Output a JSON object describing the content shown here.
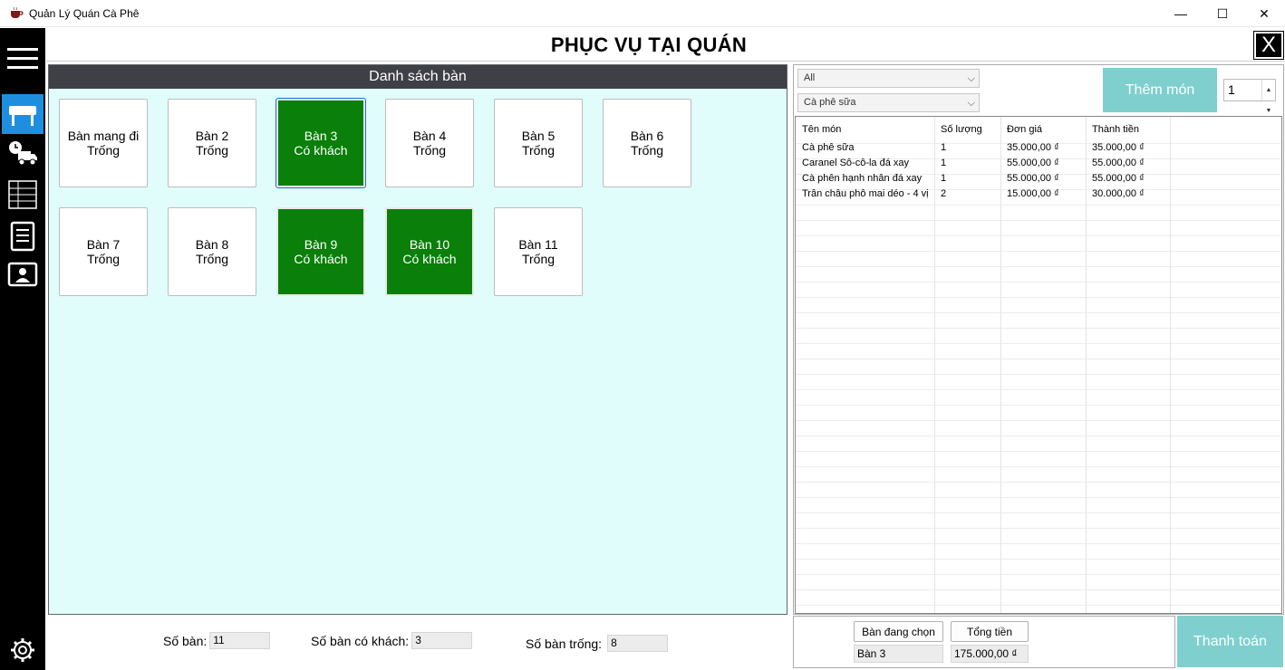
{
  "window": {
    "title": "Quản Lý Quán Cà Phê",
    "minimize": "—",
    "maximize": "☐",
    "close": "✕"
  },
  "header": {
    "title": "PHỤC VỤ TẠI QUÁN",
    "close_label": "X"
  },
  "sidebar": {
    "items": [
      "menu-icon",
      "table-service-icon",
      "delivery-icon",
      "table-list-icon",
      "receipt-icon",
      "staff-icon",
      "settings-icon"
    ]
  },
  "tables_panel": {
    "title": "Danh sách bàn",
    "tables": [
      {
        "name": "Bàn mang đi",
        "status": "Trống"
      },
      {
        "name": "Bàn 2",
        "status": "Trống"
      },
      {
        "name": "Bàn 3",
        "status": "Có khách"
      },
      {
        "name": "Bàn 4",
        "status": "Trống"
      },
      {
        "name": "Bàn 5",
        "status": "Trống"
      },
      {
        "name": "Bàn 6",
        "status": "Trống"
      },
      {
        "name": "Bàn 7",
        "status": "Trống"
      },
      {
        "name": "Bàn 8",
        "status": "Trống"
      },
      {
        "name": "Bàn 9",
        "status": "Có khách"
      },
      {
        "name": "Bàn 10",
        "status": "Có khách"
      },
      {
        "name": "Bàn 11",
        "status": "Trống"
      }
    ]
  },
  "stats": {
    "total_label": "Số bàn:",
    "total_value": "11",
    "busy_label": "Số bàn có khách:",
    "busy_value": "3",
    "free_label": "Số bàn trống:",
    "free_value": "8"
  },
  "order_panel": {
    "category_select": "All",
    "item_select": "Cà phê sữa",
    "add_button": "Thêm món",
    "quantity": "1",
    "columns": [
      "Tên món",
      "Số lượng",
      "Đơn giá",
      "Thành tiền"
    ],
    "rows": [
      [
        "Cà phê sữa",
        "1",
        "35.000,00 ₫",
        "35.000,00 ₫"
      ],
      [
        "Caranel Sô-cô-la đá xay",
        "1",
        "55.000,00 ₫",
        "55.000,00 ₫"
      ],
      [
        "Cà phên hạnh nhân đá xay",
        "1",
        "55.000,00 ₫",
        "55.000,00 ₫"
      ],
      [
        "Trân châu phô mai déo - 4 vị",
        "2",
        "15.000,00 ₫",
        "30.000,00 ₫"
      ]
    ]
  },
  "checkout": {
    "selected_table_label": "Bàn đang chọn",
    "selected_table_value": "Bàn 3",
    "total_label": "Tổng tiền",
    "total_value": "175.000,00 ₫",
    "pay_button": "Thanh toán"
  },
  "colors": {
    "busy_table": "#0a7f0a",
    "panel_bg": "#e0fcfb",
    "accent_button": "#7fcfcf",
    "active_side": "#1e8fe0"
  }
}
